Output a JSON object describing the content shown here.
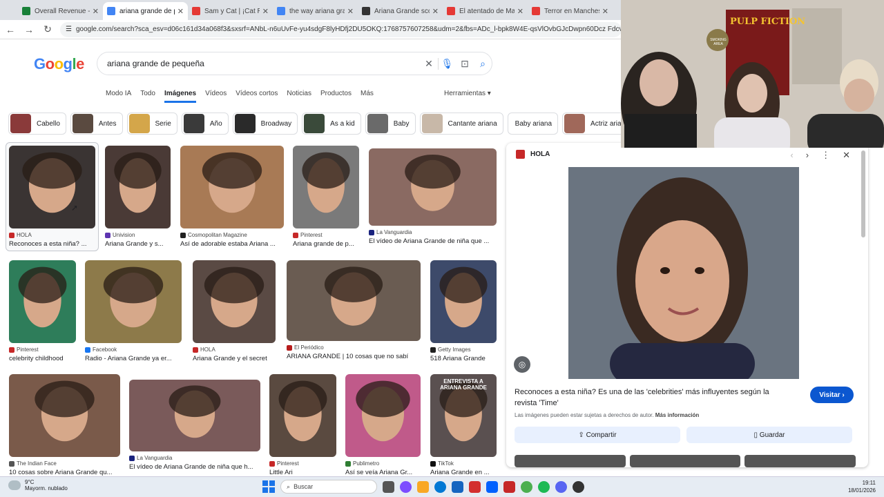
{
  "browser": {
    "tabs": [
      {
        "title": "Overall Revenue - Ki",
        "favicon": "kiwi-icon",
        "color": "#188038"
      },
      {
        "title": "ariana grande de pe",
        "favicon": "google-icon",
        "color": "#4285f4",
        "active": true
      },
      {
        "title": "Sam y Cat | ¡Cat Rock",
        "favicon": "youtube-icon",
        "color": "#e53935"
      },
      {
        "title": "the way ariana grand",
        "favicon": "google-icon",
        "color": "#4285f4"
      },
      {
        "title": "Ariana Grande scores",
        "favicon": "openai-icon",
        "color": "#333333"
      },
      {
        "title": "El atentado de Manc",
        "favicon": "youtube-icon",
        "color": "#e53935"
      },
      {
        "title": "Terror en Mancheste",
        "favicon": "youtube-icon",
        "color": "#e53935"
      }
    ],
    "url": "google.com/search?sca_esv=d06c161d34a068f3&sxsrf=ANbL-n6uUvFe-yu4sdgF8lyHDfj2DU5OKQ:1768757607258&udm=2&fbs=ADc_l-bpk8W4E-qsVlOvbGJcDwpn60Dcz FdcvPnuv8WQohHL1a"
  },
  "google": {
    "logo": "Google",
    "query": "ariana grande de pequeña",
    "tabs": [
      "Modo IA",
      "Todo",
      "Imágenes",
      "Vídeos",
      "Vídeos cortos",
      "Noticias",
      "Productos",
      "Más"
    ],
    "active_tab": "Imágenes",
    "tools": "Herramientas",
    "chips": [
      "Cabello",
      "Antes",
      "Serie",
      "Año",
      "Broadway",
      "As a kid",
      "Baby",
      "Cantante ariana",
      "Baby ariana",
      "Actriz ariana"
    ]
  },
  "results": [
    {
      "source": "HOLA",
      "caption": "Reconoces a esta niña? ...",
      "srcColor": "#c62828",
      "bg": "#3a3433"
    },
    {
      "source": "Univision",
      "caption": "Ariana Grande y s...",
      "srcColor": "#5e35b1",
      "bg": "#4a3a36"
    },
    {
      "source": "Cosmopolitan Magazine",
      "caption": "Así de adorable estaba Ariana ...",
      "srcColor": "#212121",
      "bg": "#a87a55"
    },
    {
      "source": "Pinterest",
      "caption": "Ariana grande de p...",
      "srcColor": "#c62828",
      "bg": "#7a7a7a"
    },
    {
      "source": "La Vanguardia",
      "caption": "El vídeo de Ariana Grande de niña que ...",
      "srcColor": "#1a237e",
      "bg": "#8a6a62"
    },
    {
      "source": "Pinterest",
      "caption": "celebrity childhood",
      "srcColor": "#c62828",
      "bg": "#2e7d5a"
    },
    {
      "source": "Facebook",
      "caption": "Radio - Ariana Grande ya er...",
      "srcColor": "#1877f2",
      "bg": "#8d7a4a"
    },
    {
      "source": "HOLA",
      "caption": "Ariana Grande y el secret",
      "srcColor": "#c62828",
      "bg": "#5a4a44"
    },
    {
      "source": "El Periódico",
      "caption": "ARIANA GRANDE | 10 cosas que no sabí",
      "srcColor": "#b71c1c",
      "bg": "#6a5c52"
    },
    {
      "source": "Getty Images",
      "caption": "518 Ariana Grande",
      "srcColor": "#212121",
      "bg": "#3d4a6a"
    },
    {
      "source": "The Indian Face",
      "caption": "10 cosas sobre Ariana Grande qu...",
      "srcColor": "#555555",
      "bg": "#7a5a4a"
    },
    {
      "source": "La Vanguardia",
      "caption": "El vídeo de Ariana Grande de niña que h...",
      "srcColor": "#1a237e",
      "bg": "#7a5a5a"
    },
    {
      "source": "Pinterest",
      "caption": "Little Ari",
      "srcColor": "#c62828",
      "bg": "#5a4a40"
    },
    {
      "source": "Publimetro",
      "caption": "Así se veía Ariana Gr...",
      "srcColor": "#2e7d32",
      "bg": "#c05a8a"
    },
    {
      "source": "TikTok",
      "caption": "Ariana Grande en ...",
      "srcColor": "#111111",
      "bg": "#5a5050",
      "overlay": "ENTREVISTA A ARIANA GRANDE"
    }
  ],
  "panel": {
    "source": "HOLA",
    "title": "Reconoces a esta niña? Es una de las 'celebrities' más influyentes según la revista 'Time'",
    "visit": "Visitar",
    "rights": "Las imágenes pueden estar sujetas a derechos de autor.",
    "more_info": "Más información",
    "share": "Compartir",
    "save": "Guardar"
  },
  "taskbar": {
    "temp": "9°C",
    "weather": "Mayorm. nublado",
    "search_placeholder": "Buscar",
    "time": "19:11",
    "date": "18/01/2026"
  },
  "webcam": {
    "poster_title": "PULP FICTION",
    "sign": "SMOKING AREA"
  }
}
